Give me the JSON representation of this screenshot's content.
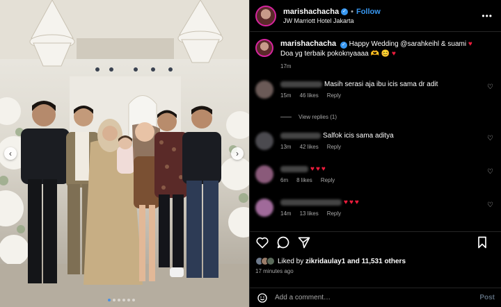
{
  "photo": {
    "description_icon": "photo-carousel",
    "prev_icon": "chevron-left-icon",
    "next_icon": "chevron-right-icon",
    "dot_count": 6,
    "active_dot": 1
  },
  "header": {
    "username": "marishachacha",
    "separator": "•",
    "follow_label": "Follow",
    "location": "JW Marriott Hotel Jakarta",
    "more_label": "•••"
  },
  "caption": {
    "username": "marishachacha",
    "text_line1": "Happy Wedding @sarahkeihl & suami",
    "text_line2": "Doa yg terbaik pokoknyaaaa",
    "time": "17m"
  },
  "comments": [
    {
      "text": "Masih serasi aja ibu icis sama dr adit",
      "time": "15m",
      "likes": "46 likes",
      "reply": "Reply"
    },
    {
      "text": "Salfok icis sama aditya",
      "time": "13m",
      "likes": "42 likes",
      "reply": "Reply"
    },
    {
      "text": "",
      "time": "6m",
      "likes": "8 likes",
      "reply": "Reply"
    },
    {
      "text": "",
      "time": "14m",
      "likes": "13 likes",
      "reply": "Reply"
    }
  ],
  "view_replies": "View replies (1)",
  "likes": {
    "prefix": "Liked by",
    "user": "zikridaulay1",
    "suffix": "and 11,531 others"
  },
  "post_time": "17 minutes ago",
  "add_comment": {
    "placeholder": "Add a comment…",
    "post_label": "Post"
  },
  "colors": {
    "accent_blue": "#3897f0",
    "heart_red": "#ed1c3c",
    "background": "#000000"
  }
}
